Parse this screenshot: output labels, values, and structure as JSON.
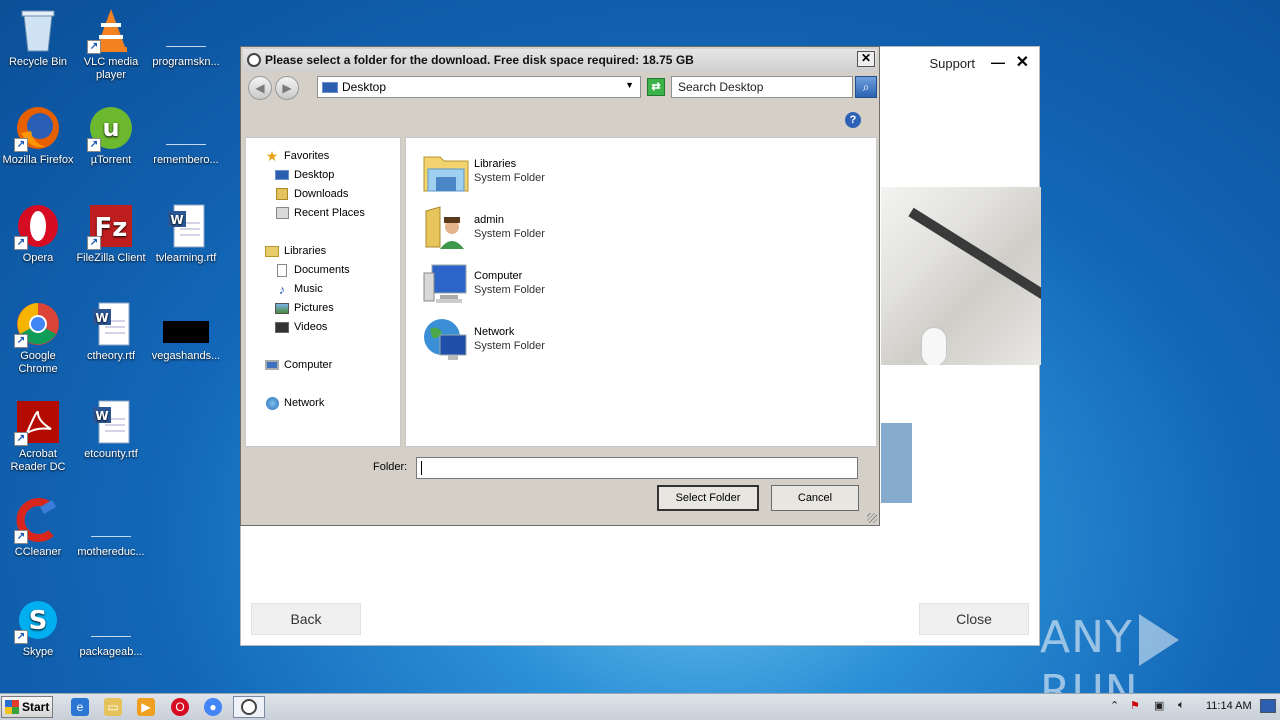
{
  "desktop": {
    "icons": [
      {
        "label": "Recycle Bin",
        "icon": "recycle-bin-icon"
      },
      {
        "label": "VLC media player",
        "icon": "vlc-icon"
      },
      {
        "label": "programskn...",
        "icon": "blank-file-icon"
      },
      {
        "label": "Mozilla Firefox",
        "icon": "firefox-icon"
      },
      {
        "label": "µTorrent",
        "icon": "utorrent-icon"
      },
      {
        "label": "remembero...",
        "icon": "blank-file-icon"
      },
      {
        "label": "Opera",
        "icon": "opera-icon"
      },
      {
        "label": "FileZilla Client",
        "icon": "filezilla-icon"
      },
      {
        "label": "tvlearning.rtf",
        "icon": "word-doc-icon"
      },
      {
        "label": "Google Chrome",
        "icon": "chrome-icon"
      },
      {
        "label": "ctheory.rtf",
        "icon": "word-doc-icon"
      },
      {
        "label": "vegashands...",
        "icon": "black-thumbnail-icon"
      },
      {
        "label": "Acrobat Reader DC",
        "icon": "acrobat-icon"
      },
      {
        "label": "etcounty.rtf",
        "icon": "word-doc-icon"
      },
      {
        "label": "CCleaner",
        "icon": "ccleaner-icon"
      },
      {
        "label": "mothereduc...",
        "icon": "blank-file-icon"
      },
      {
        "label": "Skype",
        "icon": "skype-icon"
      },
      {
        "label": "packageab...",
        "icon": "blank-file-icon"
      }
    ]
  },
  "installer": {
    "support_label": "Support",
    "minimize": "—",
    "close_x": "✕",
    "back_label": "Back",
    "close_label": "Close"
  },
  "dialog": {
    "title": "Please select a folder for the download. Free disk space required: 18.75 GB",
    "close_x": "✕",
    "back_arrow": "◀",
    "forward_arrow": "▶",
    "address": "Desktop",
    "search_placeholder": "Search Desktop",
    "help": "?",
    "tree": [
      {
        "label": "Favorites",
        "icon": "star-icon",
        "indent": false
      },
      {
        "label": "Desktop",
        "icon": "desktop-icon",
        "indent": true
      },
      {
        "label": "Downloads",
        "icon": "downloads-icon",
        "indent": true
      },
      {
        "label": "Recent Places",
        "icon": "recent-places-icon",
        "indent": true
      },
      {
        "label": "Libraries",
        "icon": "libraries-icon",
        "indent": false
      },
      {
        "label": "Documents",
        "icon": "documents-icon",
        "indent": true
      },
      {
        "label": "Music",
        "icon": "music-icon",
        "indent": true
      },
      {
        "label": "Pictures",
        "icon": "pictures-icon",
        "indent": true
      },
      {
        "label": "Videos",
        "icon": "videos-icon",
        "indent": true
      },
      {
        "label": "Computer",
        "icon": "computer-icon",
        "indent": false
      },
      {
        "label": "Network",
        "icon": "network-icon",
        "indent": false
      }
    ],
    "items": [
      {
        "name": "Libraries",
        "type": "System Folder",
        "icon": "libraries-folder-icon"
      },
      {
        "name": "admin",
        "type": "System Folder",
        "icon": "user-folder-icon"
      },
      {
        "name": "Computer",
        "type": "System Folder",
        "icon": "computer-icon"
      },
      {
        "name": "Network",
        "type": "System Folder",
        "icon": "network-globe-icon"
      }
    ],
    "folder_label": "Folder:",
    "folder_value": "",
    "select_label": "Select Folder",
    "cancel_label": "Cancel"
  },
  "watermark": {
    "left": "ANY",
    "right": "RUN"
  },
  "taskbar": {
    "start_label": "Start",
    "clock": "11:14 AM",
    "tray_up": "⌃"
  }
}
